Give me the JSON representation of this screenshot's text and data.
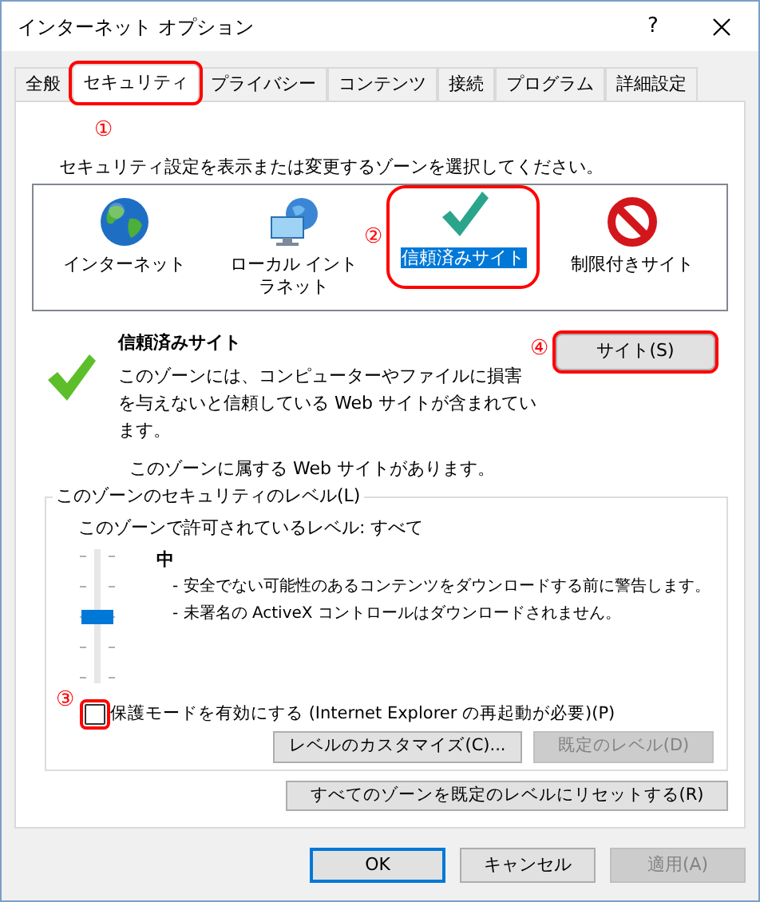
{
  "window": {
    "title": "インターネット オプション",
    "help": "?"
  },
  "tabs": [
    {
      "label": "全般",
      "selected": false
    },
    {
      "label": "セキュリティ",
      "selected": true,
      "annotation": "①"
    },
    {
      "label": "プライバシー",
      "selected": false
    },
    {
      "label": "コンテンツ",
      "selected": false
    },
    {
      "label": "接続",
      "selected": false
    },
    {
      "label": "プログラム",
      "selected": false
    },
    {
      "label": "詳細設定",
      "selected": false
    }
  ],
  "zone_prompt": "セキュリティ設定を表示または変更するゾーンを選択してください。",
  "zones": [
    {
      "label": "インターネット",
      "kind": "internet",
      "selected": false
    },
    {
      "label": "ローカル イントラネット",
      "kind": "intranet",
      "selected": false
    },
    {
      "label": "信頼済みサイト",
      "kind": "trusted",
      "selected": true,
      "annotation": "②"
    },
    {
      "label": "制限付きサイト",
      "kind": "restricted",
      "selected": false
    }
  ],
  "zone_detail": {
    "title": "信頼済みサイト",
    "description": "このゾーンには、コンピューターやファイルに損害を与えないと信頼している Web サイトが含まれています。",
    "sites_button": {
      "label": "サイト(S)",
      "annotation": "④"
    },
    "note": "このゾーンに属する Web サイトがあります。"
  },
  "security_level": {
    "legend": "このゾーンのセキュリティのレベル(L)",
    "allowed": "このゾーンで許可されているレベル: すべて",
    "level": 0.5,
    "level_name": "中",
    "bullets": [
      "- 安全でない可能性のあるコンテンツをダウンロードする前に警告します。",
      "- 未署名の ActiveX コントロールはダウンロードされません。"
    ],
    "protected_mode": {
      "label": "保護モードを有効にする (Internet Explorer の再起動が必要)(P)",
      "checked": false,
      "annotation": "③"
    },
    "buttons": [
      {
        "label": "レベルのカスタマイズ(C)...",
        "disabled": false
      },
      {
        "label": "既定のレベル(D)",
        "disabled": true
      }
    ]
  },
  "reset_button": "すべてのゾーンを既定のレベルにリセットする(R)",
  "dialog_buttons": [
    {
      "label": "OK",
      "default": true,
      "disabled": false
    },
    {
      "label": "キャンセル",
      "default": false,
      "disabled": false
    },
    {
      "label": "適用(A)",
      "default": false,
      "disabled": true
    }
  ]
}
